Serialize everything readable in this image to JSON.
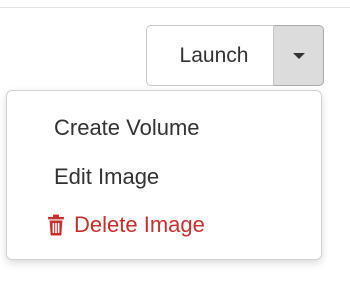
{
  "launch_button": {
    "label": "Launch",
    "toggle_icon": "caret-down-icon"
  },
  "dropdown": {
    "items": [
      {
        "label": "Create Volume"
      },
      {
        "label": "Edit Image"
      },
      {
        "label": "Delete Image",
        "icon": "trash-icon",
        "color": "#c9302c"
      }
    ]
  }
}
